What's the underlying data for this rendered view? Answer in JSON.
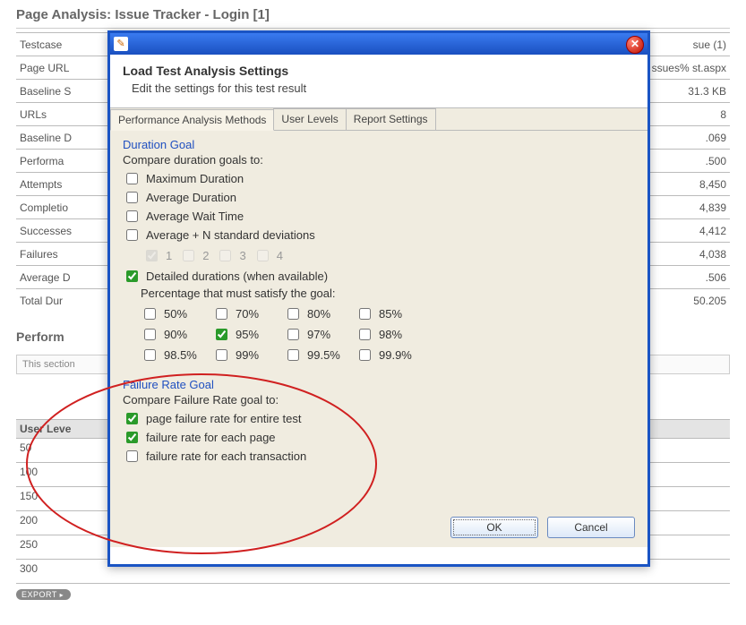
{
  "page": {
    "title": "Page Analysis: Issue Tracker - Login [1]",
    "rows": [
      {
        "label": "Testcase",
        "value": "sue (1)"
      },
      {
        "label": "Page URL",
        "value": "ssues%\nst.aspx"
      },
      {
        "label": "Baseline S",
        "value": "31.3 KB"
      },
      {
        "label": "URLs",
        "value": "8"
      },
      {
        "label": "Baseline D",
        "value": ".069"
      },
      {
        "label": "Performa",
        "value": ".500"
      },
      {
        "label": "Attempts",
        "value": "8,450"
      },
      {
        "label": "Completio",
        "value": "4,839"
      },
      {
        "label": "Successes",
        "value": "4,412"
      },
      {
        "label": "Failures",
        "value": "4,038"
      },
      {
        "label": "Average D",
        "value": ".506"
      },
      {
        "label": "Total Dur",
        "value": "50.205"
      }
    ],
    "section": "Perform",
    "note": "This section",
    "userlevel_head": "User Leve",
    "userlevels": [
      "50",
      "100",
      "150",
      "200",
      "250",
      "300"
    ],
    "export": "EXPORT"
  },
  "dialog": {
    "title": "Load Test Analysis Settings",
    "subtitle": "Edit the settings for this test result",
    "tabs": [
      "Performance Analysis Methods",
      "User Levels",
      "Report Settings"
    ],
    "duration": {
      "group": "Duration Goal",
      "compare": "Compare duration goals to:",
      "opts": [
        "Maximum Duration",
        "Average Duration",
        "Average Wait Time",
        "Average + N standard deviations"
      ],
      "n_opts": [
        "1",
        "2",
        "3",
        "4"
      ],
      "detailed": "Detailed durations (when available)",
      "pct_label": "Percentage that must satisfy the goal:",
      "pcts": [
        "50%",
        "70%",
        "80%",
        "85%",
        "90%",
        "95%",
        "97%",
        "98%",
        "98.5%",
        "99%",
        "99.5%",
        "99.9%"
      ],
      "pct_checked": "95%"
    },
    "failure": {
      "group": "Failure Rate Goal",
      "compare": "Compare Failure Rate goal to:",
      "opts": [
        {
          "label": "page failure rate for entire test",
          "checked": true
        },
        {
          "label": "failure rate for each page",
          "checked": true
        },
        {
          "label": "failure rate for each transaction",
          "checked": false
        }
      ]
    },
    "ok": "OK",
    "cancel": "Cancel"
  }
}
